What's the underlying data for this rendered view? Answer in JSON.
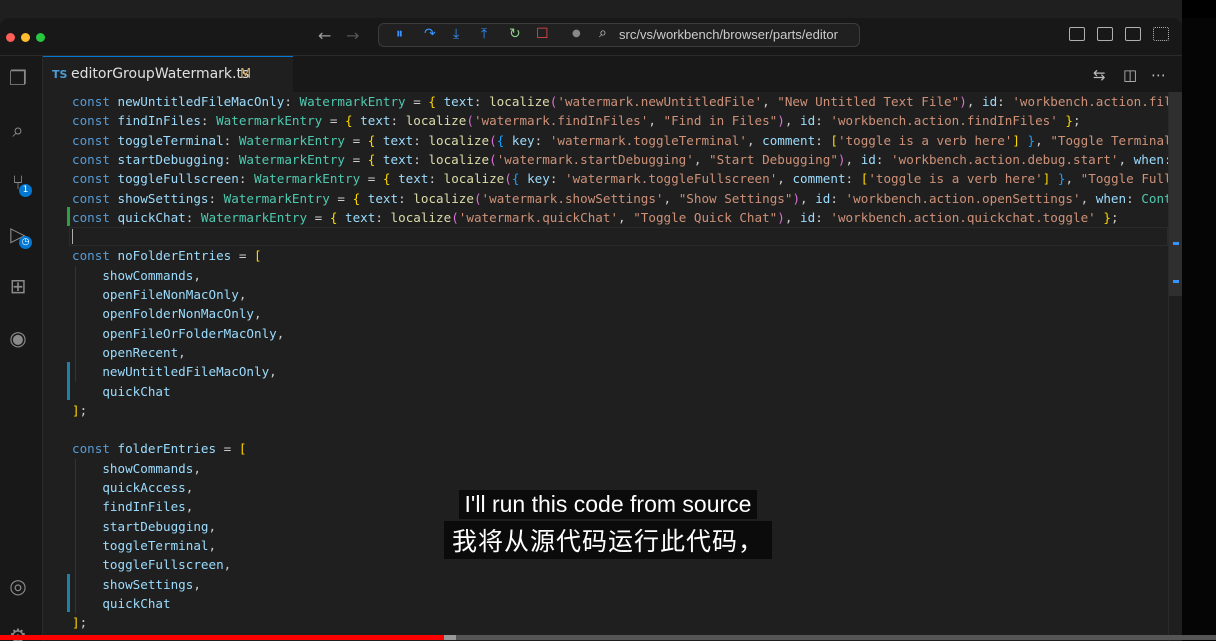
{
  "window": {
    "path": "src/vs/workbench/browser/parts/editor",
    "traffic": [
      "#ff5f57",
      "#febc2e",
      "#28c840"
    ]
  },
  "tab": {
    "lang": "TS",
    "filename": "editorGroupWatermark.ts",
    "status": "M"
  },
  "activity_badge": "1",
  "code_lines": [
    [
      [
        "k",
        "const "
      ],
      [
        "v",
        "newUntitledFileMacOnly"
      ],
      [
        "d",
        ": "
      ],
      [
        "t",
        "WatermarkEntry"
      ],
      [
        "d",
        " = "
      ],
      [
        "p",
        "{"
      ],
      [
        "d",
        " "
      ],
      [
        "v",
        "text"
      ],
      [
        "d",
        ": "
      ],
      [
        "f",
        "localize"
      ],
      [
        "pu",
        "("
      ],
      [
        "s",
        "'watermark.newUntitledFile'"
      ],
      [
        "d",
        ", "
      ],
      [
        "s",
        "\"New Untitled Text File\""
      ],
      [
        "pu",
        ")"
      ],
      [
        "d",
        ", "
      ],
      [
        "v",
        "id"
      ],
      [
        "d",
        ": "
      ],
      [
        "s",
        "'workbench.action.files"
      ]
    ],
    [
      [
        "k",
        "const "
      ],
      [
        "v",
        "findInFiles"
      ],
      [
        "d",
        ": "
      ],
      [
        "t",
        "WatermarkEntry"
      ],
      [
        "d",
        " = "
      ],
      [
        "p",
        "{"
      ],
      [
        "d",
        " "
      ],
      [
        "v",
        "text"
      ],
      [
        "d",
        ": "
      ],
      [
        "f",
        "localize"
      ],
      [
        "pu",
        "("
      ],
      [
        "s",
        "'watermark.findInFiles'"
      ],
      [
        "d",
        ", "
      ],
      [
        "s",
        "\"Find in Files\""
      ],
      [
        "pu",
        ")"
      ],
      [
        "d",
        ", "
      ],
      [
        "v",
        "id"
      ],
      [
        "d",
        ": "
      ],
      [
        "s",
        "'workbench.action.findInFiles'"
      ],
      [
        "d",
        " "
      ],
      [
        "p",
        "}"
      ],
      [
        "d",
        ";"
      ]
    ],
    [
      [
        "k",
        "const "
      ],
      [
        "v",
        "toggleTerminal"
      ],
      [
        "d",
        ": "
      ],
      [
        "t",
        "WatermarkEntry"
      ],
      [
        "d",
        " = "
      ],
      [
        "p",
        "{"
      ],
      [
        "d",
        " "
      ],
      [
        "v",
        "text"
      ],
      [
        "d",
        ": "
      ],
      [
        "f",
        "localize"
      ],
      [
        "pu",
        "("
      ],
      [
        "pl",
        "{"
      ],
      [
        "d",
        " "
      ],
      [
        "v",
        "key"
      ],
      [
        "d",
        ": "
      ],
      [
        "s",
        "'watermark.toggleTerminal'"
      ],
      [
        "d",
        ", "
      ],
      [
        "v",
        "comment"
      ],
      [
        "d",
        ": "
      ],
      [
        "p",
        "["
      ],
      [
        "s",
        "'toggle is a verb here'"
      ],
      [
        "p",
        "]"
      ],
      [
        "d",
        " "
      ],
      [
        "pl",
        "}"
      ],
      [
        "d",
        ", "
      ],
      [
        "s",
        "\"Toggle Terminal\""
      ],
      [
        "pu",
        ")"
      ]
    ],
    [
      [
        "k",
        "const "
      ],
      [
        "v",
        "startDebugging"
      ],
      [
        "d",
        ": "
      ],
      [
        "t",
        "WatermarkEntry"
      ],
      [
        "d",
        " = "
      ],
      [
        "p",
        "{"
      ],
      [
        "d",
        " "
      ],
      [
        "v",
        "text"
      ],
      [
        "d",
        ": "
      ],
      [
        "f",
        "localize"
      ],
      [
        "pu",
        "("
      ],
      [
        "s",
        "'watermark.startDebugging'"
      ],
      [
        "d",
        ", "
      ],
      [
        "s",
        "\"Start Debugging\""
      ],
      [
        "pu",
        ")"
      ],
      [
        "d",
        ", "
      ],
      [
        "v",
        "id"
      ],
      [
        "d",
        ": "
      ],
      [
        "s",
        "'workbench.action.debug.start'"
      ],
      [
        "d",
        ", "
      ],
      [
        "v",
        "when"
      ],
      [
        "d",
        ": "
      ],
      [
        "t",
        "Co"
      ]
    ],
    [
      [
        "k",
        "const "
      ],
      [
        "v",
        "toggleFullscreen"
      ],
      [
        "d",
        ": "
      ],
      [
        "t",
        "WatermarkEntry"
      ],
      [
        "d",
        " = "
      ],
      [
        "p",
        "{"
      ],
      [
        "d",
        " "
      ],
      [
        "v",
        "text"
      ],
      [
        "d",
        ": "
      ],
      [
        "f",
        "localize"
      ],
      [
        "pu",
        "("
      ],
      [
        "pl",
        "{"
      ],
      [
        "d",
        " "
      ],
      [
        "v",
        "key"
      ],
      [
        "d",
        ": "
      ],
      [
        "s",
        "'watermark.toggleFullscreen'"
      ],
      [
        "d",
        ", "
      ],
      [
        "v",
        "comment"
      ],
      [
        "d",
        ": "
      ],
      [
        "p",
        "["
      ],
      [
        "s",
        "'toggle is a verb here'"
      ],
      [
        "p",
        "]"
      ],
      [
        "d",
        " "
      ],
      [
        "pl",
        "}"
      ],
      [
        "d",
        ", "
      ],
      [
        "s",
        "\"Toggle Full S"
      ]
    ],
    [
      [
        "k",
        "const "
      ],
      [
        "v",
        "showSettings"
      ],
      [
        "d",
        ": "
      ],
      [
        "t",
        "WatermarkEntry"
      ],
      [
        "d",
        " = "
      ],
      [
        "p",
        "{"
      ],
      [
        "d",
        " "
      ],
      [
        "v",
        "text"
      ],
      [
        "d",
        ": "
      ],
      [
        "f",
        "localize"
      ],
      [
        "pu",
        "("
      ],
      [
        "s",
        "'watermark.showSettings'"
      ],
      [
        "d",
        ", "
      ],
      [
        "s",
        "\"Show Settings\""
      ],
      [
        "pu",
        ")"
      ],
      [
        "d",
        ", "
      ],
      [
        "v",
        "id"
      ],
      [
        "d",
        ": "
      ],
      [
        "s",
        "'workbench.action.openSettings'"
      ],
      [
        "d",
        ", "
      ],
      [
        "v",
        "when"
      ],
      [
        "d",
        ": "
      ],
      [
        "t",
        "Contex"
      ]
    ],
    [
      [
        "k",
        "const "
      ],
      [
        "v",
        "quickChat"
      ],
      [
        "d",
        ": "
      ],
      [
        "t",
        "WatermarkEntry"
      ],
      [
        "d",
        " = "
      ],
      [
        "p",
        "{"
      ],
      [
        "d",
        " "
      ],
      [
        "v",
        "text"
      ],
      [
        "d",
        ": "
      ],
      [
        "f",
        "localize"
      ],
      [
        "pu",
        "("
      ],
      [
        "s",
        "'watermark.quickChat'"
      ],
      [
        "d",
        ", "
      ],
      [
        "s",
        "\"Toggle Quick Chat\""
      ],
      [
        "pu",
        ")"
      ],
      [
        "d",
        ", "
      ],
      [
        "v",
        "id"
      ],
      [
        "d",
        ": "
      ],
      [
        "s",
        "'workbench.action.quickchat.toggle'"
      ],
      [
        "d",
        " "
      ],
      [
        "p",
        "}"
      ],
      [
        "d",
        ";"
      ]
    ],
    [],
    [
      [
        "k",
        "const "
      ],
      [
        "v",
        "noFolderEntries"
      ],
      [
        "d",
        " = "
      ],
      [
        "p",
        "["
      ]
    ],
    [
      [
        "d",
        "    "
      ],
      [
        "v",
        "showCommands"
      ],
      [
        "d",
        ","
      ]
    ],
    [
      [
        "d",
        "    "
      ],
      [
        "v",
        "openFileNonMacOnly"
      ],
      [
        "d",
        ","
      ]
    ],
    [
      [
        "d",
        "    "
      ],
      [
        "v",
        "openFolderNonMacOnly"
      ],
      [
        "d",
        ","
      ]
    ],
    [
      [
        "d",
        "    "
      ],
      [
        "v",
        "openFileOrFolderMacOnly"
      ],
      [
        "d",
        ","
      ]
    ],
    [
      [
        "d",
        "    "
      ],
      [
        "v",
        "openRecent"
      ],
      [
        "d",
        ","
      ]
    ],
    [
      [
        "d",
        "    "
      ],
      [
        "v",
        "newUntitledFileMacOnly"
      ],
      [
        "d",
        ","
      ]
    ],
    [
      [
        "d",
        "    "
      ],
      [
        "v",
        "quickChat"
      ]
    ],
    [
      [
        "p",
        "]"
      ],
      [
        "d",
        ";"
      ]
    ],
    [],
    [
      [
        "k",
        "const "
      ],
      [
        "v",
        "folderEntries"
      ],
      [
        "d",
        " = "
      ],
      [
        "p",
        "["
      ]
    ],
    [
      [
        "d",
        "    "
      ],
      [
        "v",
        "showCommands"
      ],
      [
        "d",
        ","
      ]
    ],
    [
      [
        "d",
        "    "
      ],
      [
        "v",
        "quickAccess"
      ],
      [
        "d",
        ","
      ]
    ],
    [
      [
        "d",
        "    "
      ],
      [
        "v",
        "findInFiles"
      ],
      [
        "d",
        ","
      ]
    ],
    [
      [
        "d",
        "    "
      ],
      [
        "v",
        "startDebugging"
      ],
      [
        "d",
        ","
      ]
    ],
    [
      [
        "d",
        "    "
      ],
      [
        "v",
        "toggleTerminal"
      ],
      [
        "d",
        ","
      ]
    ],
    [
      [
        "d",
        "    "
      ],
      [
        "v",
        "toggleFullscreen"
      ],
      [
        "d",
        ","
      ]
    ],
    [
      [
        "d",
        "    "
      ],
      [
        "v",
        "showSettings"
      ],
      [
        "d",
        ","
      ]
    ],
    [
      [
        "d",
        "    "
      ],
      [
        "v",
        "quickChat"
      ]
    ],
    [
      [
        "p",
        "]"
      ],
      [
        "d",
        ";"
      ]
    ]
  ],
  "subtitles": {
    "en": "I'll run this code from source",
    "zh": "我将从源代码运行此代码，"
  },
  "video_progress": {
    "played": 0.365,
    "buffered": 0.375
  }
}
